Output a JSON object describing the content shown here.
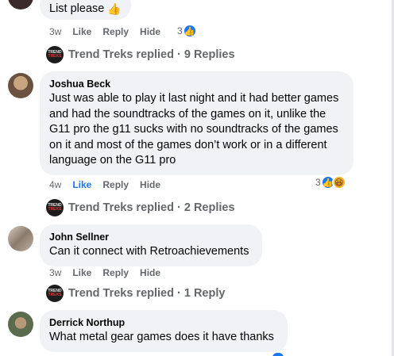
{
  "comments": [
    {
      "text": "List please",
      "emoji": "👍",
      "time": "3w",
      "like_label": "Like",
      "reply_label": "Reply",
      "hide_label": "Hide",
      "reaction_count": "3"
    },
    {
      "author": "Joshua Beck",
      "text": "Just was able to play it last night and it had better games and had the soundtracks of the games on it, unlike the G11 pro the g11 sucks with no soundtracks of the games on it and most of the games don’t work or in a different language on the G11 pro",
      "time": "4w",
      "like_label": "Like",
      "reply_label": "Reply",
      "hide_label": "Hide",
      "reaction_count": "3"
    },
    {
      "author": "John Sellner",
      "text": "Can it connect with Retroachievements",
      "time": "3w",
      "like_label": "Like",
      "reply_label": "Reply",
      "hide_label": "Hide"
    },
    {
      "author": "Derrick Northup",
      "text": "What metal gear games does it have thanks"
    }
  ],
  "replies": [
    {
      "text": "Trend Treks replied · 9 Replies"
    },
    {
      "text": "Trend Treks replied · 2 Replies"
    },
    {
      "text": "Trend Treks replied · 1 Reply"
    }
  ],
  "logo_text": {
    "top": "TREND",
    "bottom": "TREKS"
  },
  "icons": {
    "like": "like-icon",
    "haha": "haha-icon",
    "thumb": "thumbs-up-emoji"
  },
  "colors": {
    "accent": "#1877f2",
    "bubble": "#f0f2f5",
    "muted": "#65676b"
  }
}
